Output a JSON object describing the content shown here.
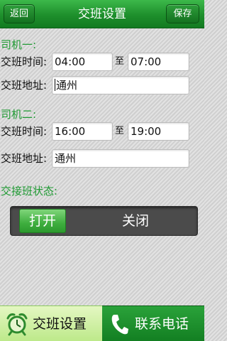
{
  "header": {
    "back_label": "返回",
    "title": "交班设置",
    "save_label": "保存"
  },
  "driver1": {
    "section_label": "司机一:",
    "time_label": "交班时间:",
    "start_time": "04:00",
    "to_label": "至",
    "end_time": "07:00",
    "address_label": "交班地址:",
    "address": "通州"
  },
  "driver2": {
    "section_label": "司机二:",
    "time_label": "交班时间:",
    "start_time": "16:00",
    "to_label": "至",
    "end_time": "19:00",
    "address_label": "交班地址:",
    "address": "通州"
  },
  "status": {
    "section_label": "交接班状态:",
    "on_label": "打开",
    "off_label": "关闭",
    "selected": "打开"
  },
  "tabs": [
    {
      "label": "交班设置",
      "icon": "alarm-clock-icon",
      "active": true
    },
    {
      "label": "联系电话",
      "icon": "phone-icon",
      "active": false
    }
  ],
  "colors": {
    "accent_green": "#1e8f2c",
    "section_green": "#1f9a33",
    "active_tab": "#bde98a"
  }
}
